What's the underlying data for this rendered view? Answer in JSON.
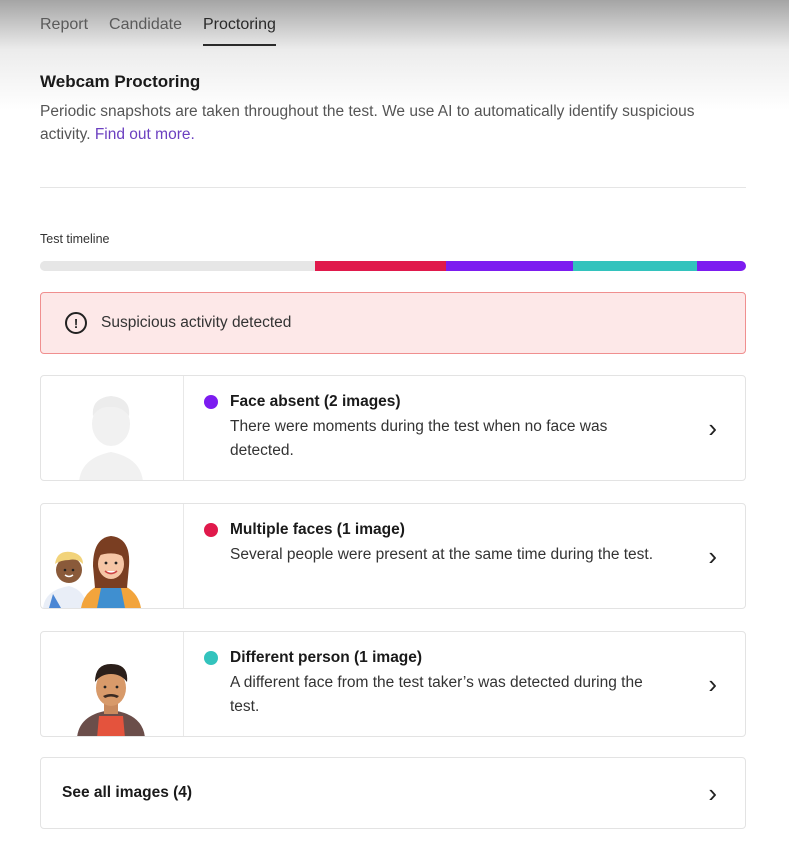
{
  "tabs": [
    {
      "label": "Report"
    },
    {
      "label": "Candidate"
    },
    {
      "label": "Proctoring",
      "active": true
    }
  ],
  "section": {
    "title": "Webcam Proctoring",
    "description": "Periodic snapshots are taken throughout the test. We use AI to automatically identify suspicious activity.",
    "link": "Find out more."
  },
  "timeline": {
    "label": "Test timeline",
    "segments": [
      {
        "color": "#e6e6e6",
        "fraction": 0.39
      },
      {
        "color": "#e0194b",
        "fraction": 0.185
      },
      {
        "color": "#7c1cf0",
        "fraction": 0.18
      },
      {
        "color": "#33c3bd",
        "fraction": 0.175
      },
      {
        "color": "#7c1cf0",
        "fraction": 0.07
      }
    ]
  },
  "alert": {
    "text": "Suspicious activity detected",
    "icon": "exclamation-circle-icon"
  },
  "cards": [
    {
      "title": "Face absent (2 images)",
      "description": "There were moments during the test when no face was detected.",
      "dot_color": "#7c1cf0",
      "illustration": "silhouette"
    },
    {
      "title": "Multiple faces (1 image)",
      "description": "Several people were present at the same time during the test.",
      "dot_color": "#e0194b",
      "illustration": "two-people"
    },
    {
      "title": "Different person (1 image)",
      "description": "A different face from the test taker’s was detected during the test.",
      "dot_color": "#33c3bd",
      "illustration": "man"
    }
  ],
  "see_all": {
    "label": "See all images (4)"
  }
}
